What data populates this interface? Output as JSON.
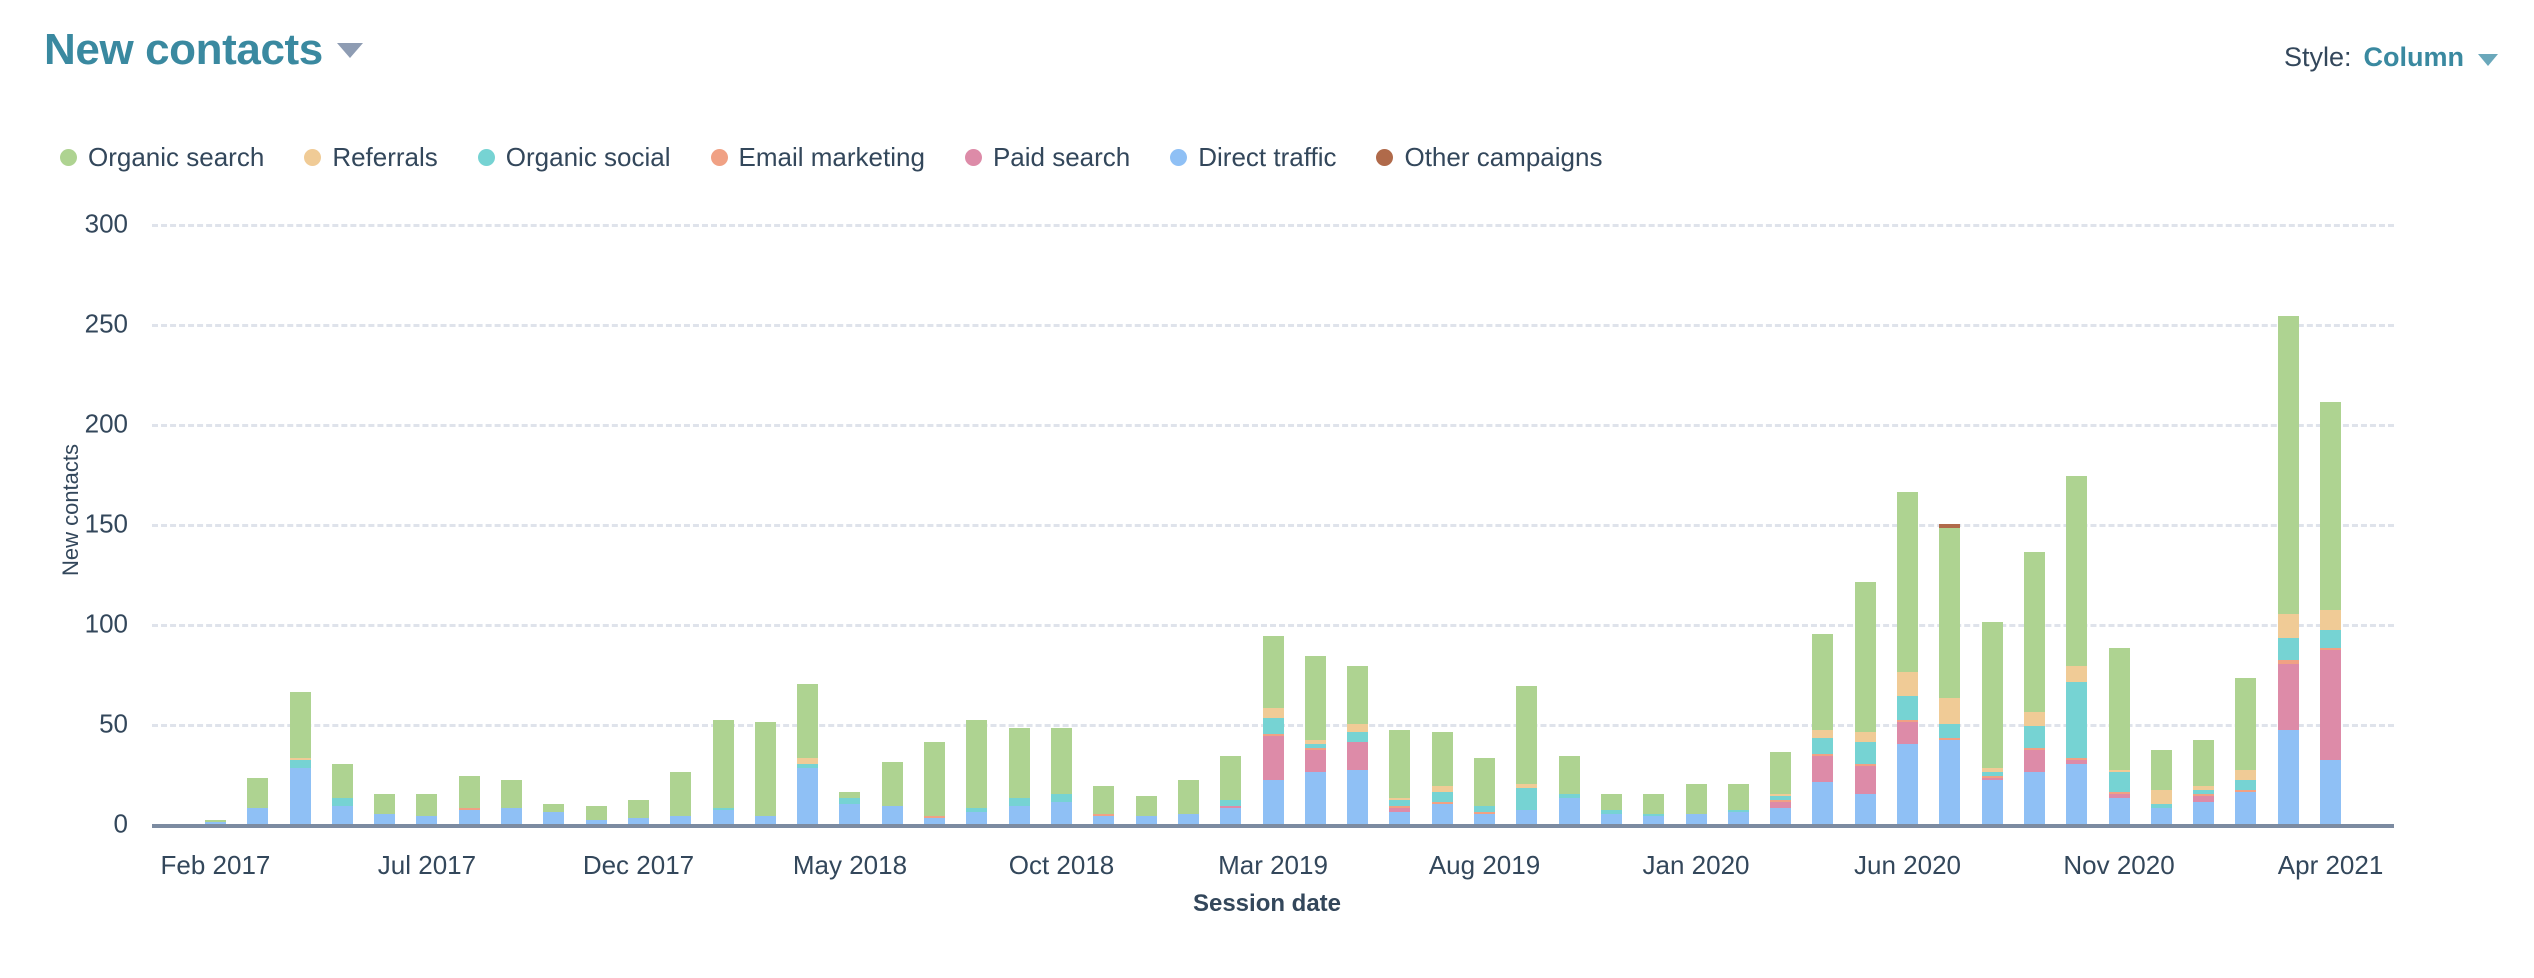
{
  "header": {
    "title": "New contacts",
    "title_caret_icon": "chevron-down-icon",
    "style_label": "Style:",
    "style_value": "Column",
    "style_caret_icon": "chevron-down-icon"
  },
  "colors": {
    "title": "#3a89a0",
    "text": "#33475b",
    "grid": "#dfe3eb",
    "axis": "#7c8ba1",
    "organic_search": "#aed391",
    "referrals": "#f0cb96",
    "organic_social": "#76d3d3",
    "email_marketing": "#f0a184",
    "paid_search": "#dd8ba8",
    "direct_traffic": "#8fc0f5",
    "other_campaigns": "#b06a4a"
  },
  "chart_data": {
    "type": "bar",
    "stacked": true,
    "title": "New contacts",
    "xlabel": "Session date",
    "ylabel": "New contacts",
    "ylim": [
      0,
      300
    ],
    "yticks": [
      0,
      50,
      100,
      150,
      200,
      250,
      300
    ],
    "grid": true,
    "legend_position": "top-left",
    "xtick_labels": [
      "Feb 2017",
      "Jul 2017",
      "Dec 2017",
      "May 2018",
      "Oct 2018",
      "Mar 2019",
      "Aug 2019",
      "Jan 2020",
      "Jun 2020",
      "Nov 2020",
      "Apr 2021"
    ],
    "xtick_indices": [
      1,
      6,
      11,
      16,
      21,
      26,
      31,
      36,
      41,
      46,
      51
    ],
    "categories": [
      "Jan 2017",
      "Feb 2017",
      "Mar 2017",
      "Apr 2017",
      "May 2017",
      "Jun 2017",
      "Jul 2017",
      "Aug 2017",
      "Sep 2017",
      "Oct 2017",
      "Nov 2017",
      "Dec 2017",
      "Jan 2018",
      "Feb 2018",
      "Mar 2018",
      "Apr 2018",
      "May 2018",
      "Jun 2018",
      "Jul 2018",
      "Aug 2018",
      "Sep 2018",
      "Oct 2018",
      "Nov 2018",
      "Dec 2018",
      "Jan 2019",
      "Feb 2019",
      "Mar 2019",
      "Apr 2019",
      "May 2019",
      "Jun 2019",
      "Jul 2019",
      "Aug 2019",
      "Sep 2019",
      "Oct 2019",
      "Nov 2019",
      "Dec 2019",
      "Jan 2020",
      "Feb 2020",
      "Mar 2020",
      "Apr 2020",
      "May 2020",
      "Jun 2020",
      "Jul 2020",
      "Aug 2020",
      "Sep 2020",
      "Oct 2020",
      "Nov 2020",
      "Dec 2020",
      "Jan 2021",
      "Feb 2021",
      "Mar 2021",
      "Apr 2021",
      "May 2021"
    ],
    "series": [
      {
        "name": "Direct traffic",
        "color": "#8fc0f5",
        "values": [
          0,
          1,
          8,
          28,
          9,
          5,
          4,
          7,
          8,
          6,
          2,
          3,
          4,
          7,
          4,
          28,
          10,
          9,
          3,
          6,
          9,
          11,
          4,
          4,
          5,
          8,
          22,
          26,
          27,
          6,
          10,
          5,
          7,
          13,
          5,
          4,
          5,
          6,
          8,
          21,
          15,
          40,
          42,
          22,
          26,
          30,
          13,
          8,
          11,
          16,
          47,
          32,
          0
        ]
      },
      {
        "name": "Paid search",
        "color": "#dd8ba8",
        "values": [
          0,
          0,
          0,
          0,
          0,
          0,
          0,
          0,
          0,
          0,
          0,
          0,
          0,
          0,
          0,
          0,
          0,
          0,
          0,
          0,
          0,
          0,
          0,
          0,
          0,
          1,
          22,
          11,
          14,
          2,
          0,
          0,
          0,
          0,
          0,
          0,
          0,
          0,
          3,
          13,
          14,
          11,
          0,
          1,
          11,
          2,
          2,
          0,
          3,
          0,
          33,
          55,
          0
        ]
      },
      {
        "name": "Email marketing",
        "color": "#f0a184",
        "values": [
          0,
          0,
          0,
          0,
          0,
          0,
          0,
          1,
          0,
          0,
          0,
          0,
          0,
          0,
          0,
          0,
          0,
          0,
          1,
          0,
          0,
          0,
          1,
          0,
          0,
          0,
          1,
          1,
          0,
          1,
          1,
          1,
          0,
          0,
          0,
          0,
          0,
          0,
          1,
          1,
          1,
          1,
          1,
          1,
          1,
          1,
          1,
          0,
          1,
          1,
          2,
          1,
          0
        ]
      },
      {
        "name": "Organic social",
        "color": "#76d3d3",
        "values": [
          0,
          0,
          0,
          4,
          4,
          0,
          0,
          0,
          0,
          0,
          0,
          0,
          0,
          1,
          0,
          2,
          3,
          0,
          0,
          2,
          4,
          4,
          0,
          0,
          0,
          3,
          8,
          2,
          5,
          3,
          5,
          3,
          11,
          2,
          2,
          1,
          0,
          1,
          2,
          8,
          11,
          12,
          7,
          2,
          11,
          38,
          10,
          2,
          2,
          5,
          11,
          9,
          0
        ]
      },
      {
        "name": "Referrals",
        "color": "#f0cb96",
        "values": [
          0,
          0,
          0,
          1,
          0,
          0,
          0,
          0,
          0,
          0,
          0,
          0,
          0,
          0,
          0,
          3,
          0,
          0,
          0,
          0,
          0,
          0,
          0,
          0,
          0,
          0,
          5,
          2,
          4,
          1,
          3,
          0,
          2,
          0,
          0,
          0,
          0,
          0,
          1,
          4,
          5,
          12,
          13,
          2,
          7,
          8,
          1,
          7,
          2,
          5,
          12,
          10,
          0
        ]
      },
      {
        "name": "Organic search",
        "color": "#aed391",
        "values": [
          0,
          1,
          15,
          33,
          17,
          10,
          11,
          16,
          14,
          4,
          7,
          9,
          22,
          44,
          47,
          37,
          3,
          22,
          37,
          44,
          35,
          33,
          14,
          10,
          17,
          22,
          36,
          42,
          29,
          34,
          27,
          24,
          49,
          19,
          8,
          10,
          15,
          13,
          21,
          48,
          75,
          90,
          85,
          73,
          80,
          95,
          61,
          20,
          23,
          46,
          149,
          104,
          0
        ]
      },
      {
        "name": "Other campaigns",
        "color": "#b06a4a",
        "values": [
          0,
          0,
          0,
          0,
          0,
          0,
          0,
          0,
          0,
          0,
          0,
          0,
          0,
          0,
          0,
          0,
          0,
          0,
          0,
          0,
          0,
          0,
          0,
          0,
          0,
          0,
          0,
          0,
          0,
          0,
          0,
          0,
          0,
          0,
          0,
          0,
          0,
          0,
          0,
          0,
          0,
          0,
          2,
          0,
          0,
          0,
          0,
          0,
          0,
          0,
          0,
          0,
          0
        ]
      }
    ],
    "totals": [
      0,
      2,
      23,
      66,
      30,
      15,
      15,
      24,
      22,
      10,
      9,
      12,
      26,
      52,
      51,
      70,
      16,
      31,
      41,
      52,
      48,
      48,
      19,
      14,
      22,
      34,
      94,
      84,
      79,
      47,
      46,
      33,
      69,
      34,
      16,
      15,
      20,
      20,
      36,
      95,
      121,
      166,
      150,
      101,
      136,
      174,
      88,
      37,
      42,
      73,
      254,
      211,
      0
    ]
  },
  "legend": {
    "items": [
      {
        "label": "Organic search",
        "color": "#aed391"
      },
      {
        "label": "Referrals",
        "color": "#f0cb96"
      },
      {
        "label": "Organic social",
        "color": "#76d3d3"
      },
      {
        "label": "Email marketing",
        "color": "#f0a184"
      },
      {
        "label": "Paid search",
        "color": "#dd8ba8"
      },
      {
        "label": "Direct traffic",
        "color": "#8fc0f5"
      },
      {
        "label": "Other campaigns",
        "color": "#b06a4a"
      }
    ]
  }
}
